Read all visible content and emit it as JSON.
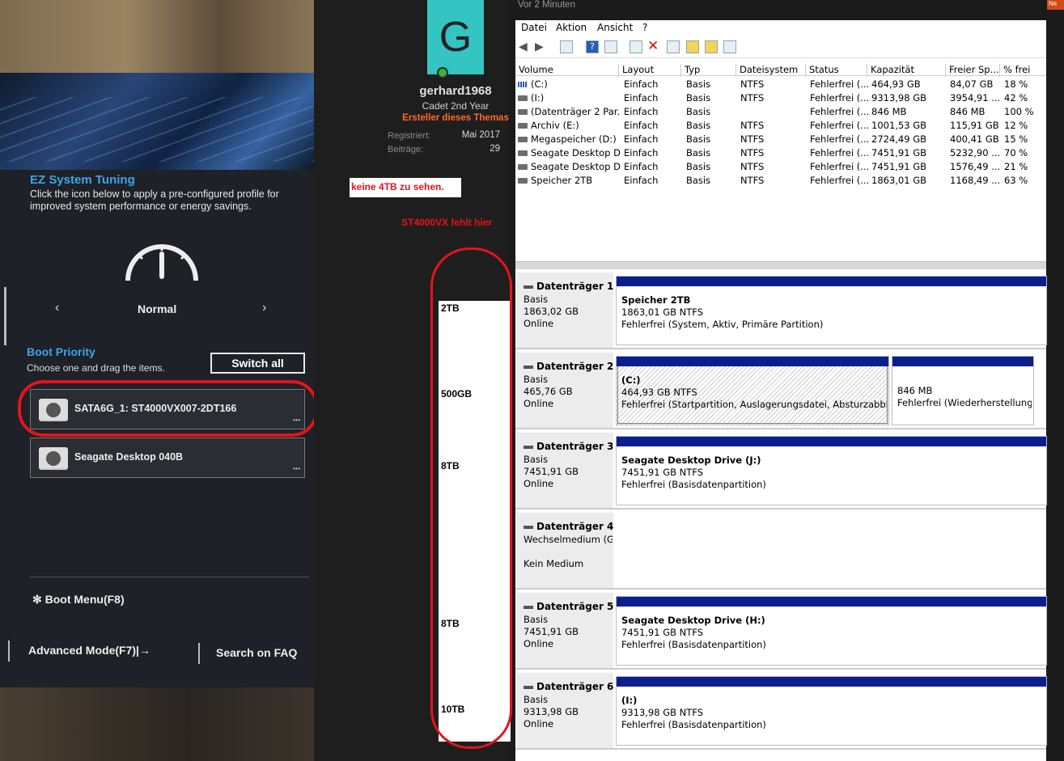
{
  "bios": {
    "ez_title": "EZ System Tuning",
    "ez_desc": "Click the icon below to apply a pre-configured profile for improved system performance or energy savings.",
    "mode": "Normal",
    "boot_title": "Boot Priority",
    "boot_desc": "Choose one and drag the items.",
    "switch_all": "Switch all",
    "drives": [
      "SATA6G_1: ST4000VX007-2DT166",
      "Seagate Desktop 040B"
    ],
    "boot_menu": "Boot Menu(F8)",
    "advanced": "Advanced Mode(F7)|→",
    "search": "Search on FAQ"
  },
  "forum": {
    "avatar_letter": "G",
    "username": "gerhard1968",
    "rank": "Cadet 2nd Year",
    "creator": "Ersteller dieses Themas",
    "reg_label": "Registriert:",
    "reg_value": "Mai 2017",
    "posts_label": "Beiträge:",
    "posts_value": "29",
    "time": "Vor 2 Minuten",
    "badge": "Ne"
  },
  "annotations": {
    "note1": "keine 4TB zu sehen.",
    "note2": "ST4000VX fehlt hier",
    "sizes": [
      "2TB",
      "500GB",
      "8TB",
      "8TB",
      "10TB"
    ]
  },
  "dm": {
    "menu": [
      "Datei",
      "Aktion",
      "Ansicht",
      "?"
    ],
    "columns": [
      "Volume",
      "Layout",
      "Typ",
      "Dateisystem",
      "Status",
      "Kapazität",
      "Freier Sp...",
      "% frei"
    ],
    "rows": [
      [
        "(C:)",
        "Einfach",
        "Basis",
        "NTFS",
        "Fehlerfrei (...",
        "464,93 GB",
        "84,07 GB",
        "18 %"
      ],
      [
        "(I:)",
        "Einfach",
        "Basis",
        "NTFS",
        "Fehlerfrei (...",
        "9313,98 GB",
        "3954,91 ...",
        "42 %"
      ],
      [
        "(Datenträger 2 Par...",
        "Einfach",
        "Basis",
        "",
        "Fehlerfrei (...",
        "846 MB",
        "846 MB",
        "100 %"
      ],
      [
        "Archiv (E:)",
        "Einfach",
        "Basis",
        "NTFS",
        "Fehlerfrei (...",
        "1001,53 GB",
        "115,91 GB",
        "12 %"
      ],
      [
        "Megaspeicher (D:)",
        "Einfach",
        "Basis",
        "NTFS",
        "Fehlerfrei (...",
        "2724,49 GB",
        "400,41 GB",
        "15 %"
      ],
      [
        "Seagate Desktop D...",
        "Einfach",
        "Basis",
        "NTFS",
        "Fehlerfrei (...",
        "7451,91 GB",
        "5232,90 ...",
        "70 %"
      ],
      [
        "Seagate Desktop D...",
        "Einfach",
        "Basis",
        "NTFS",
        "Fehlerfrei (...",
        "7451,91 GB",
        "1576,49 ...",
        "21 %"
      ],
      [
        "Speicher 2TB",
        "Einfach",
        "Basis",
        "NTFS",
        "Fehlerfrei (...",
        "1863,01 GB",
        "1168,49 ...",
        "63 %"
      ]
    ],
    "disks": [
      {
        "name": "Datenträger 1",
        "type": "Basis",
        "size": "1863,02 GB",
        "state": "Online",
        "parts": [
          {
            "label": "Speicher 2TB",
            "size": "1863,01 GB NTFS",
            "status": "Fehlerfrei (System, Aktiv, Primäre Partition)"
          }
        ]
      },
      {
        "name": "Datenträger 2",
        "type": "Basis",
        "size": "465,76 GB",
        "state": "Online",
        "parts": [
          {
            "label": "(C:)",
            "size": "464,93 GB NTFS",
            "status": "Fehlerfrei (Startpartition, Auslagerungsdatei, Absturzabbild, Pr"
          },
          {
            "label": "",
            "size": "846 MB",
            "status": "Fehlerfrei (Wiederherstellungs"
          }
        ]
      },
      {
        "name": "Datenträger 3",
        "type": "Basis",
        "size": "7451,91 GB",
        "state": "Online",
        "parts": [
          {
            "label": "Seagate Desktop Drive  (J:)",
            "size": "7451,91 GB NTFS",
            "status": "Fehlerfrei (Basisdatenpartition)"
          }
        ]
      },
      {
        "name": "Datenträger 4",
        "type": "Wechselmedium (G:",
        "size": "",
        "state": "Kein Medium",
        "parts": []
      },
      {
        "name": "Datenträger 5",
        "type": "Basis",
        "size": "7451,91 GB",
        "state": "Online",
        "parts": [
          {
            "label": "Seagate Desktop Drive  (H:)",
            "size": "7451,91 GB NTFS",
            "status": "Fehlerfrei (Basisdatenpartition)"
          }
        ]
      },
      {
        "name": "Datenträger 6",
        "type": "Basis",
        "size": "9313,98 GB",
        "state": "Online",
        "parts": [
          {
            "label": "(I:)",
            "size": "9313,98 GB NTFS",
            "status": "Fehlerfrei (Basisdatenpartition)"
          }
        ]
      }
    ]
  }
}
